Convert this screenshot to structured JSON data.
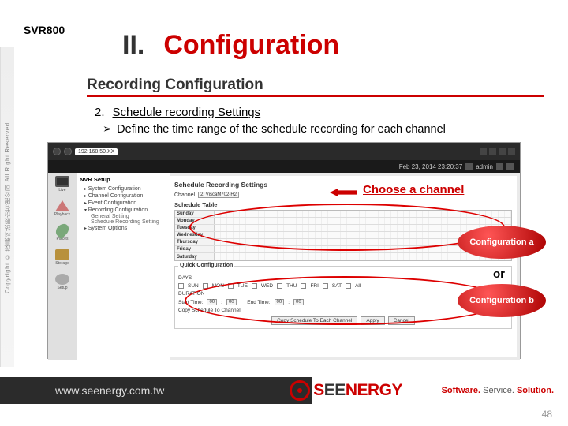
{
  "model": "SVR800",
  "title": {
    "numeral": "II.",
    "word": "Configuration"
  },
  "subtitle": "Recording Configuration",
  "step": {
    "num": "2.",
    "text": "Schedule recording Settings"
  },
  "bullet": {
    "marker": "➢",
    "text": "Define the time range of the schedule recording for each channel"
  },
  "annot_choose": "Choose a channel",
  "config_a": "Configuration a",
  "config_b": "Configuration b",
  "or": "or",
  "sidebar_copy": "Copyright © 茂晨科技股份有限公司 All Right Reserved.",
  "footer_url": "www.seenergy.com.tw",
  "logo": {
    "p1": "S",
    "p2": "EE",
    "p3": "NERGY"
  },
  "tagline": {
    "a": "Software.",
    "b": "Service.",
    "c": "Solution."
  },
  "page_num": "48",
  "screenshot": {
    "addr": "192.168.50.XX",
    "date": "Feb 23, 2014 23:20:37",
    "user": "admin",
    "nav_header": "NVR Setup",
    "nav": {
      "sys": "System Configuration",
      "chan": "Channel Configuration",
      "event": "Event Configuration",
      "rec": "Recording Configuration",
      "gen": "General Setting",
      "sched": "Schedule Recording Setting",
      "sysopt": "System Options"
    },
    "icons": {
      "live": "Live",
      "playback": "Playback",
      "places": "Places",
      "storage": "Storage",
      "setup": "Setup"
    },
    "main_header": "Schedule Recording Settings",
    "channel_label": "Channel",
    "channel_value": "2. ViscaM702-H2",
    "sched_table": "Schedule Table",
    "days": [
      "Sunday",
      "Monday",
      "Tuesday",
      "Wednesday",
      "Thursday",
      "Friday",
      "Saturday"
    ],
    "quick": {
      "label": "Quick Configuration",
      "days_lbl": "DAYS",
      "d": {
        "sun": "SUN",
        "mon": "MON",
        "tue": "TUE",
        "wed": "WED",
        "thu": "THU",
        "fri": "FRI",
        "sat": "SAT",
        "all": "All"
      },
      "duration": "DURATION",
      "start": "Start Time:",
      "end": "End Time:",
      "h": "00",
      "m": "00",
      "copy_label": "Copy Schedule To Channel",
      "btn_copy": "Copy Schedule To Each Channel",
      "btn_apply": "Apply",
      "btn_cancel": "Cancel"
    }
  }
}
